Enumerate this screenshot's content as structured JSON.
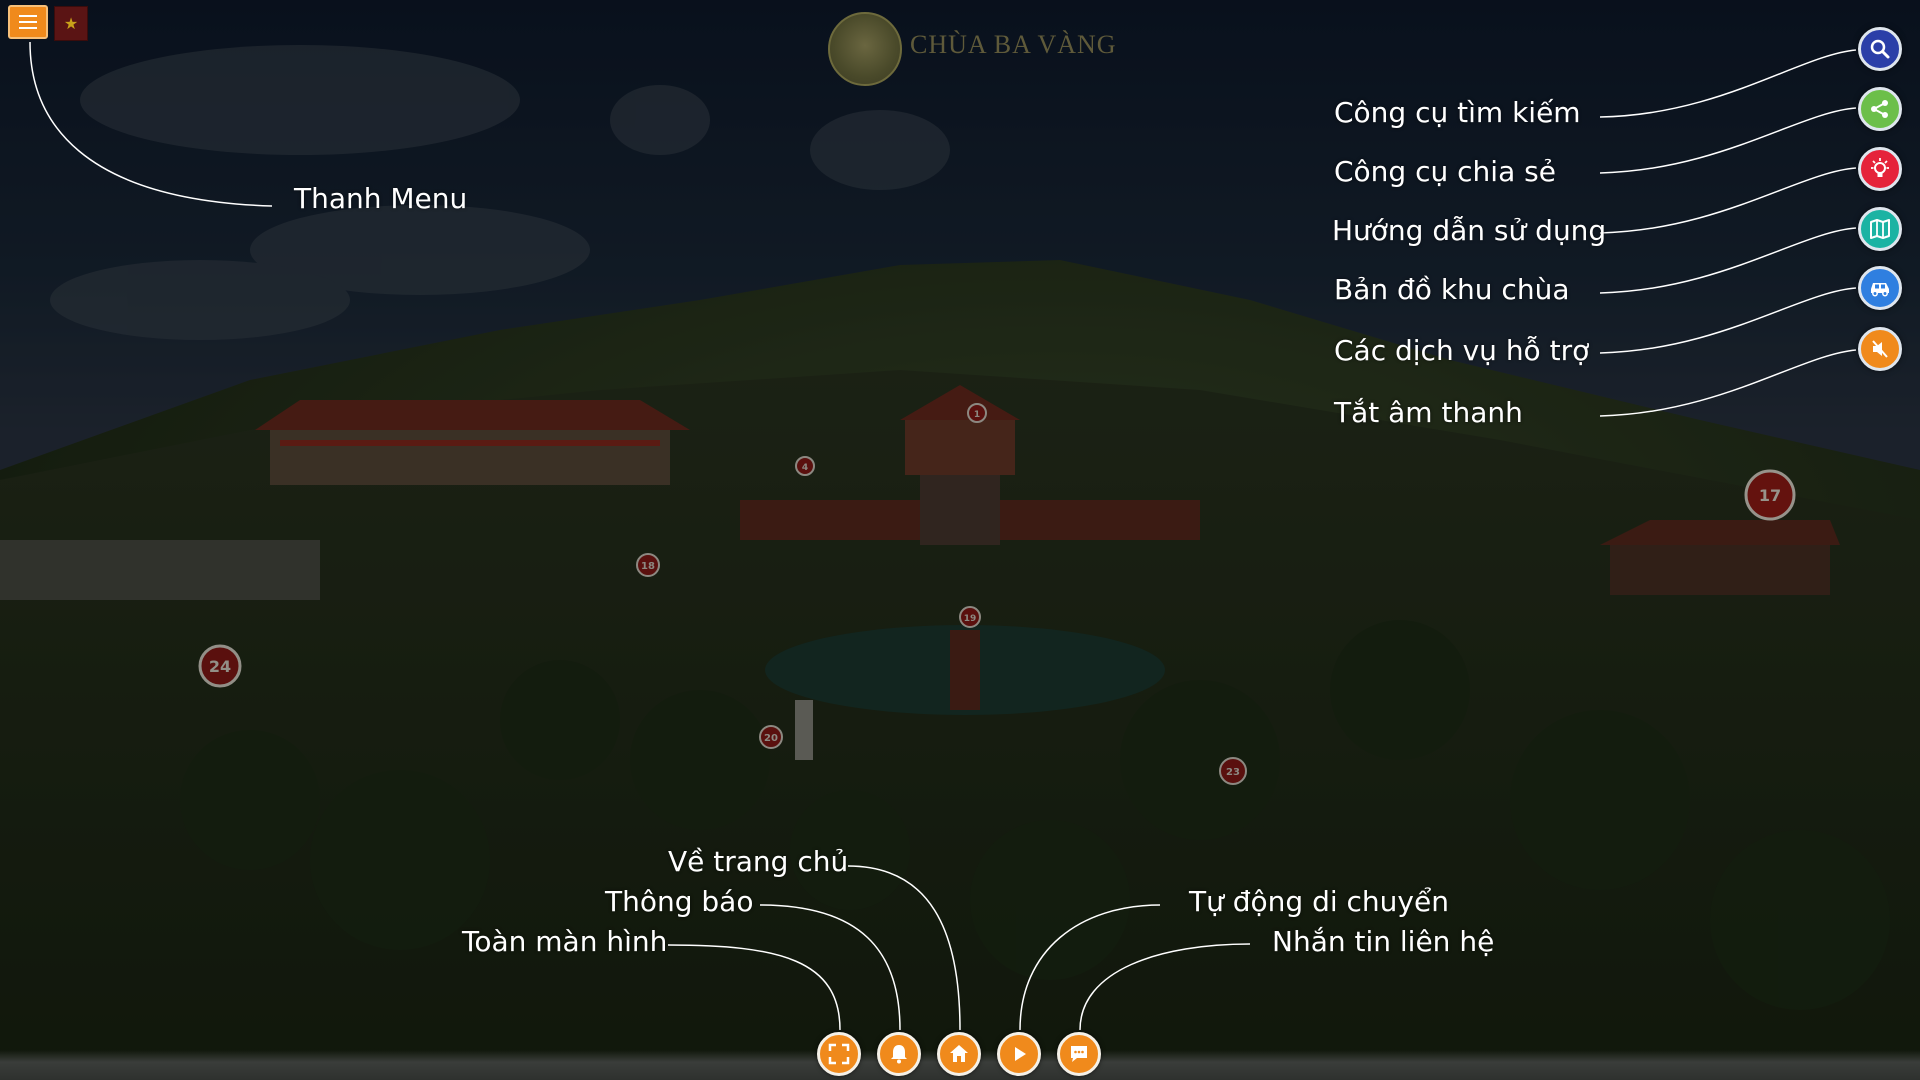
{
  "header": {
    "menu_icon": "hamburger-icon",
    "language_flag": "vietnam-flag-icon",
    "logo_text": "CHÙA BA VÀNG",
    "brand_color": "#f08a1c"
  },
  "annotations": {
    "menu": "Thanh Menu",
    "search": "Công cụ tìm kiếm",
    "share": "Công cụ chia sẻ",
    "guide": "Hướng dẫn sử dụng",
    "map": "Bản đồ khu chùa",
    "services": "Các dịch vụ hỗ trợ",
    "mute": "Tắt âm thanh",
    "home": "Về trang chủ",
    "notify": "Thông báo",
    "fullscreen": "Toàn màn hình",
    "autoplay": "Tự động di chuyển",
    "message": "Nhắn tin liên hệ"
  },
  "right_tools": [
    {
      "name": "search",
      "icon": "search-icon",
      "color": "#2b3fa8"
    },
    {
      "name": "share",
      "icon": "share-icon",
      "color": "#6cbf4a"
    },
    {
      "name": "guide",
      "icon": "lightbulb-icon",
      "color": "#e5233a"
    },
    {
      "name": "map",
      "icon": "map-icon",
      "color": "#1bb3a3"
    },
    {
      "name": "services",
      "icon": "car-icon",
      "color": "#2f7fe0"
    },
    {
      "name": "mute",
      "icon": "mute-icon",
      "color": "#f08a1c"
    }
  ],
  "bottom_tools": [
    {
      "name": "fullscreen",
      "icon": "fullscreen-icon"
    },
    {
      "name": "notify",
      "icon": "bell-icon"
    },
    {
      "name": "home",
      "icon": "home-icon"
    },
    {
      "name": "autoplay",
      "icon": "play-icon"
    },
    {
      "name": "message",
      "icon": "chat-icon"
    }
  ],
  "panorama_markers": [
    "17",
    "24",
    "18",
    "20",
    "23",
    "19",
    "4",
    "1"
  ]
}
